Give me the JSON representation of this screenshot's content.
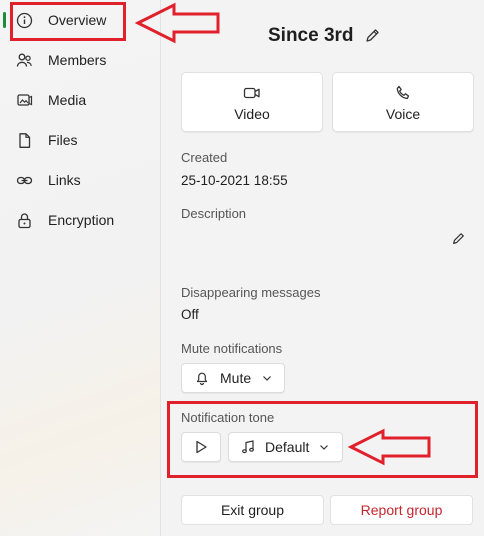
{
  "sidebar": {
    "items": [
      {
        "label": "Overview",
        "icon": "info-icon"
      },
      {
        "label": "Members",
        "icon": "people-icon"
      },
      {
        "label": "Media",
        "icon": "media-icon"
      },
      {
        "label": "Files",
        "icon": "file-icon"
      },
      {
        "label": "Links",
        "icon": "link-icon"
      },
      {
        "label": "Encryption",
        "icon": "lock-icon"
      }
    ],
    "active_index": 0
  },
  "header": {
    "title": "Since 3rd"
  },
  "call_buttons": {
    "video_label": "Video",
    "voice_label": "Voice"
  },
  "created": {
    "label": "Created",
    "value": "25-10-2021 18:55"
  },
  "description": {
    "label": "Description"
  },
  "disappearing": {
    "label": "Disappearing messages",
    "value": "Off"
  },
  "mute": {
    "label": "Mute notifications",
    "value": "Mute"
  },
  "tone": {
    "label": "Notification tone",
    "value": "Default"
  },
  "footer": {
    "exit_label": "Exit group",
    "report_label": "Report group"
  },
  "colors": {
    "accent_green": "#1e8a3a",
    "annotation_red": "#e0212b",
    "report_red": "#c4262e"
  }
}
